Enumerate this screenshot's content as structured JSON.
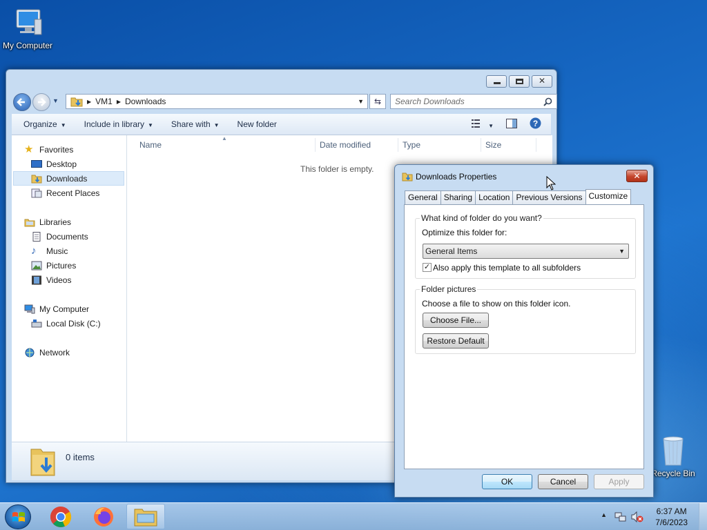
{
  "desktop": {
    "my_computer_label": "My Computer",
    "recycle_bin_label": "Recycle Bin"
  },
  "explorer": {
    "breadcrumb": [
      "VM1",
      "Downloads"
    ],
    "search_placeholder": "Search Downloads",
    "toolbar": {
      "organize": "Organize",
      "include_in_library": "Include in library",
      "share_with": "Share with",
      "new_folder": "New folder"
    },
    "nav": {
      "favorites": "Favorites",
      "desktop": "Desktop",
      "downloads": "Downloads",
      "recent_places": "Recent Places",
      "libraries": "Libraries",
      "documents": "Documents",
      "music": "Music",
      "pictures": "Pictures",
      "videos": "Videos",
      "my_computer": "My Computer",
      "local_disk": "Local Disk (C:)",
      "network": "Network"
    },
    "columns": {
      "name": "Name",
      "date_modified": "Date modified",
      "type": "Type",
      "size": "Size"
    },
    "empty_message": "This folder is empty.",
    "item_count": "0 items"
  },
  "dialog": {
    "title": "Downloads Properties",
    "tabs": [
      "General",
      "Sharing",
      "Location",
      "Previous Versions",
      "Customize"
    ],
    "active_tab": "Customize",
    "folder_kind_group": "What kind of folder do you want?",
    "optimize_label": "Optimize this folder for:",
    "optimize_value": "General Items",
    "apply_subfolders_label": "Also apply this template to all subfolders",
    "apply_subfolders_checked": true,
    "folder_pictures_group": "Folder pictures",
    "choose_file_label": "Choose a file to show on this folder icon.",
    "choose_file_button": "Choose File...",
    "restore_default_button": "Restore Default",
    "ok_button": "OK",
    "cancel_button": "Cancel",
    "apply_button": "Apply"
  },
  "taskbar": {
    "time": "6:37 AM",
    "date": "7/6/2023"
  }
}
